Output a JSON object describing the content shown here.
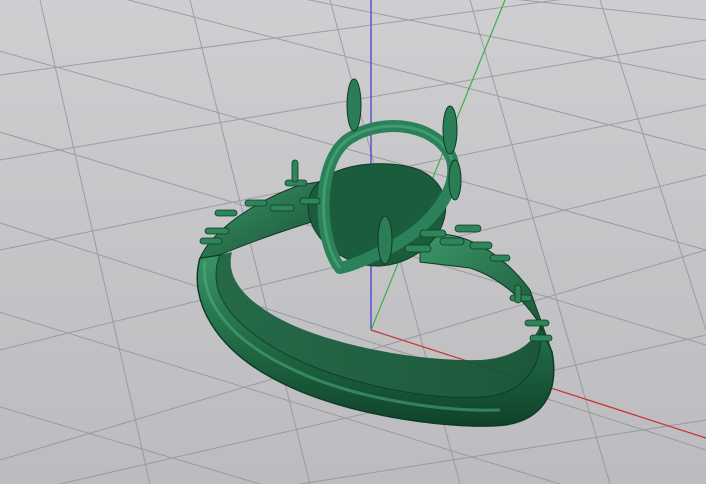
{
  "viewport": {
    "projection": "perspective",
    "background_color": "#c7c7ca",
    "grid": {
      "visible": true,
      "color": "#8e8e93"
    },
    "axes": {
      "x": {
        "color": "#c8322b"
      },
      "y": {
        "color": "#3fae49"
      },
      "z": {
        "color": "#3a3ad0"
      }
    }
  },
  "model": {
    "object": "ring",
    "color": "#216e48",
    "highlight_color": "#3f9a6b",
    "shadow_color": "#113d28"
  }
}
